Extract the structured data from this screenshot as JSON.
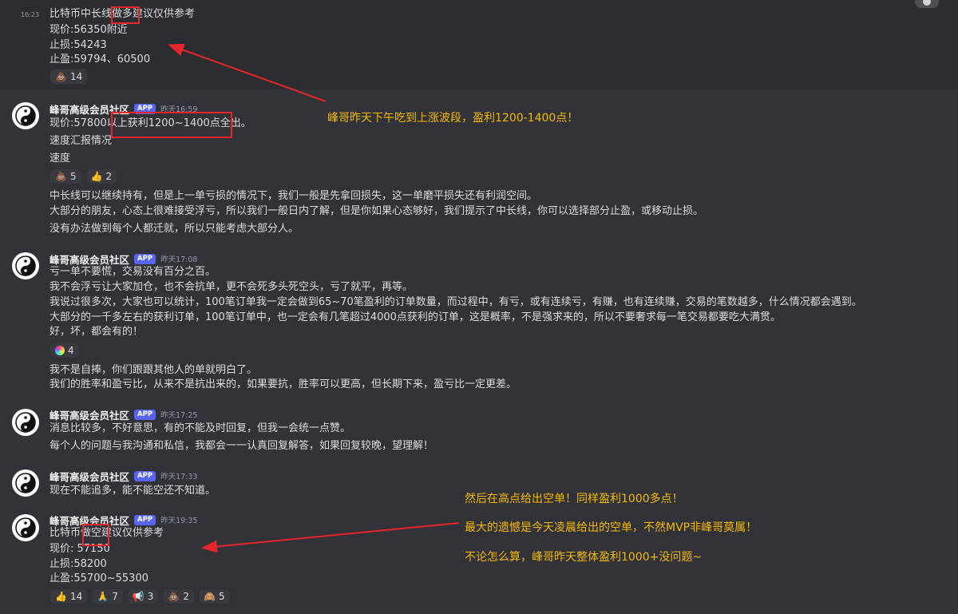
{
  "colors": {
    "background": "#313338",
    "top_band": "#2b2d31",
    "app_badge": "#5865f2",
    "annotation": "#f5b800",
    "highlight_box": "#e6262a"
  },
  "messages": [
    {
      "time": "16:23",
      "lines": [
        "比特币中长线做多建议仅供参考",
        "现价:56350附近",
        "止损:54243",
        "止盈:59794、60500"
      ],
      "reactions": [
        {
          "icon": "poop-emoji",
          "glyph": "💩",
          "count": "14"
        }
      ]
    },
    {
      "username": "峰哥高级会员社区",
      "badge": "APP",
      "timestamp": "昨天16:59",
      "lines": [
        "现价:57800以上获利1200~1400点全出。",
        "速度汇报情况",
        "速度"
      ],
      "reactions": [
        {
          "icon": "poop-emoji",
          "glyph": "💩",
          "count": "5"
        },
        {
          "icon": "thumbs-up-emoji",
          "glyph": "👍",
          "count": "2"
        }
      ],
      "followups": [
        "中长线可以继续持有，但是上一单亏损的情况下，我们一般是先拿回损失，这一单磨平损失还有利润空间。",
        "大部分的朋友，心态上很难接受浮亏，所以我们一般日内了解，但是你如果心态够好，我们提示了中长线，你可以选择部分止盈，或移动止损。",
        "没有办法做到每个人都迁就，所以只能考虑大部分人。"
      ]
    },
    {
      "username": "峰哥高级会员社区",
      "badge": "APP",
      "timestamp": "昨天17:08",
      "lines": [
        "亏一单不要慌，交易没有百分之百。",
        "我不会浮亏让大家加仓，也不会抗单，更不会死多头死空头，亏了就平，再等。",
        "我说过很多次，大家也可以统计，100笔订单我一定会做到65~70笔盈利的订单数量，而过程中，有亏，或有连续亏，有赚，也有连续赚，交易的笔数越多，什么情况都会遇到。",
        "大部分的一千多左右的获利订单，100笔订单中，也一定会有几笔超过4000点获利的订单，这是概率，不是强求来的，所以不要奢求每一笔交易都要吃大满贯。",
        "好，坏，都会有的！"
      ],
      "reactions": [
        {
          "icon": "rainbow-circle-emoji",
          "glyph": "",
          "count": "4"
        }
      ],
      "followups": [
        "我不是自捧，你们跟跟其他人的单就明白了。",
        "我们的胜率和盈亏比，从来不是抗出来的，如果要抗，胜率可以更高，但长期下来，盈亏比一定更差。"
      ]
    },
    {
      "username": "峰哥高级会员社区",
      "badge": "APP",
      "timestamp": "昨天17:25",
      "lines": [
        "消息比较多，不好意思，有的不能及时回复，但我一会统一点赞。",
        "每个人的问题与我沟通和私信，我都会一一认真回复解答，如果回复较晚，望理解！"
      ]
    },
    {
      "username": "峰哥高级会员社区",
      "badge": "APP",
      "timestamp": "昨天17:33",
      "lines": [
        "现在不能追多，能不能空还不知道。"
      ]
    },
    {
      "username": "峰哥高级会员社区",
      "badge": "APP",
      "timestamp": "昨天19:35",
      "lines": [
        "比特币做空建议仅供参考",
        "现价: 57150",
        "止损:58200",
        "止盈:55700~55300"
      ],
      "reactions": [
        {
          "icon": "thumbs-up-emoji",
          "glyph": "👍",
          "count": "14"
        },
        {
          "icon": "folded-hands-emoji",
          "glyph": "🙏",
          "count": "7"
        },
        {
          "icon": "megaphone-emoji",
          "glyph": "📢",
          "count": "3"
        },
        {
          "icon": "poop-emoji",
          "glyph": "💩",
          "count": "2"
        },
        {
          "icon": "see-no-evil-monkey-emoji",
          "glyph": "🙈",
          "count": "5"
        }
      ]
    }
  ],
  "annotations": {
    "a1": "峰哥昨天下午吃到上涨波段，盈利1200-1400点！",
    "a2": "然后在高点给出空单！同样盈利1000多点！",
    "a3": "最大的遗憾是今天凌晨给出的空单，不然MVP非峰哥莫属！",
    "a4": "不论怎么算，峰哥昨天整体盈利1000+没问题~"
  }
}
